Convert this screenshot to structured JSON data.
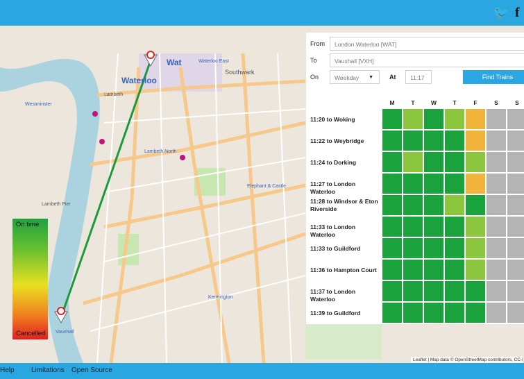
{
  "header": {
    "twitter_icon": "twitter-icon",
    "facebook_icon": "facebook-icon"
  },
  "form": {
    "from_label": "From",
    "from_value": "London Waterloo [WAT]",
    "to_label": "To",
    "to_value": "Vauxhall [VXH]",
    "on_label": "On",
    "on_value": "Weekday",
    "at_label": "At",
    "at_value": "11:17",
    "find_button": "Find Trains"
  },
  "days": [
    "M",
    "T",
    "W",
    "T",
    "F",
    "S",
    "S"
  ],
  "colors": {
    "green": "#1aa33c",
    "light_green": "#8cc63e",
    "amber": "#f0b43a",
    "grey": "#b4b4b4",
    "accent": "#2aa7e0"
  },
  "trains": [
    {
      "label": "11:20 to Woking",
      "status": [
        "green",
        "light_green",
        "green",
        "light_green",
        "amber",
        "grey",
        "grey"
      ]
    },
    {
      "label": "11:22 to Weybridge",
      "status": [
        "green",
        "green",
        "green",
        "green",
        "amber",
        "grey",
        "grey"
      ]
    },
    {
      "label": "11:24 to Dorking",
      "status": [
        "green",
        "light_green",
        "green",
        "green",
        "light_green",
        "grey",
        "grey"
      ]
    },
    {
      "label": "11:27 to London Waterloo",
      "status": [
        "green",
        "green",
        "green",
        "green",
        "amber",
        "grey",
        "grey"
      ]
    },
    {
      "label": "11:28 to Windsor & Eton Riverside",
      "status": [
        "green",
        "green",
        "green",
        "light_green",
        "green",
        "grey",
        "grey"
      ]
    },
    {
      "label": "11:33 to London Waterloo",
      "status": [
        "green",
        "green",
        "green",
        "green",
        "light_green",
        "grey",
        "grey"
      ]
    },
    {
      "label": "11:33 to Guildford",
      "status": [
        "green",
        "green",
        "green",
        "green",
        "light_green",
        "grey",
        "grey"
      ]
    },
    {
      "label": "11:36 to Hampton Court",
      "status": [
        "green",
        "green",
        "green",
        "green",
        "light_green",
        "grey",
        "grey"
      ]
    },
    {
      "label": "11:37 to London Waterloo",
      "status": [
        "green",
        "green",
        "green",
        "green",
        "green",
        "grey",
        "grey"
      ]
    },
    {
      "label": "11:39 to Guildford",
      "status": [
        "green",
        "green",
        "green",
        "green",
        "green",
        "grey",
        "grey"
      ]
    }
  ],
  "legend": {
    "top": "On time",
    "bottom": "Cancelled"
  },
  "map": {
    "labels": {
      "waterloo": "Waterloo",
      "wat": "Wat",
      "westminster": "Westminster",
      "lambeth": "Lambeth",
      "lambeth_north": "Lambeth North",
      "elephant": "Elephant & Castle",
      "kennington": "Kennington",
      "vauxhall": "Vauxhall",
      "southwark": "Southwark",
      "waterloo_east": "Waterloo East",
      "lambeth_pier": "Lambeth Pier"
    },
    "attribution": "Leaflet | Map data © OpenStreetMap contributors, CC-BY"
  },
  "footer": {
    "help": "Help",
    "limitations": "Limitations",
    "open_source": "Open Source"
  }
}
